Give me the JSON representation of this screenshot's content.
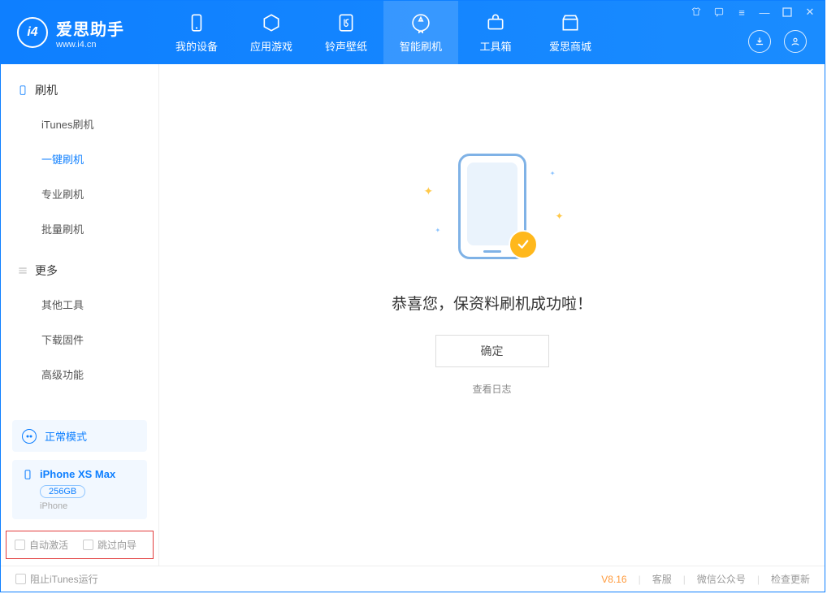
{
  "app": {
    "title": "爱思助手",
    "url": "www.i4.cn"
  },
  "nav": {
    "items": [
      {
        "label": "我的设备"
      },
      {
        "label": "应用游戏"
      },
      {
        "label": "铃声壁纸"
      },
      {
        "label": "智能刷机"
      },
      {
        "label": "工具箱"
      },
      {
        "label": "爱思商城"
      }
    ]
  },
  "sidebar": {
    "group1_title": "刷机",
    "group1_items": [
      "iTunes刷机",
      "一键刷机",
      "专业刷机",
      "批量刷机"
    ],
    "group2_title": "更多",
    "group2_items": [
      "其他工具",
      "下载固件",
      "高级功能"
    ],
    "status_label": "正常模式",
    "device": {
      "name": "iPhone XS Max",
      "capacity": "256GB",
      "type": "iPhone"
    },
    "checkbox1": "自动激活",
    "checkbox2": "跳过向导"
  },
  "main": {
    "success_message": "恭喜您，保资料刷机成功啦！",
    "confirm_label": "确定",
    "view_log_label": "查看日志"
  },
  "footer": {
    "block_itunes": "阻止iTunes运行",
    "version": "V8.16",
    "links": [
      "客服",
      "微信公众号",
      "检查更新"
    ]
  }
}
